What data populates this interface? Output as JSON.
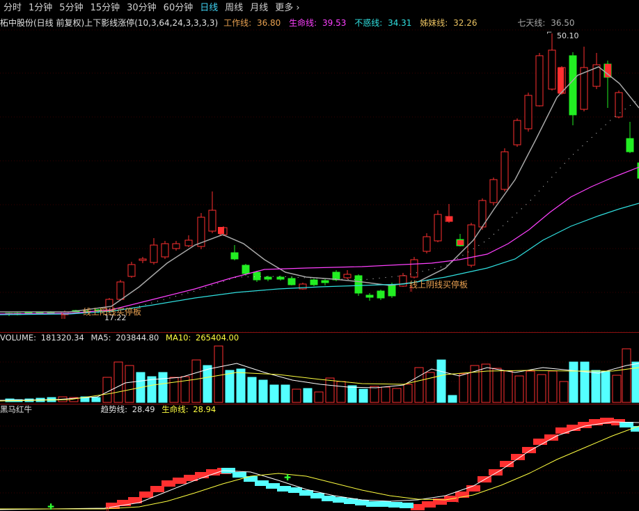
{
  "toolbar": {
    "items": [
      "分时",
      "1分钟",
      "5分钟",
      "15分钟",
      "30分钟",
      "60分钟",
      "日线",
      "周线",
      "月线"
    ],
    "active": "日线",
    "more": "更多",
    "more_icon": "chevron-right-icon"
  },
  "header": {
    "stock": "柘中股份(日线 前复权)",
    "indicator": "上下影线涨停(10,3,64,24,3,3,3,3)",
    "work_label": "工作线:",
    "work_value": "36.80",
    "life_label": "生命线:",
    "life_value": "39.53",
    "bhx_label": "不惑线:",
    "bhx_value": "34.31",
    "sister_label": "姊妹线:",
    "sister_value": "32.26",
    "seven_label": "七天线:",
    "seven_value": "36.50"
  },
  "price_chart": {
    "high_label": "50.10",
    "low_label": "17.22",
    "annotation_left": "线上阳线买停板",
    "annotation_right": "线上阴线买停板"
  },
  "volume_panel": {
    "volume_label": "VOLUME:",
    "volume_value": "181320.34",
    "ma5_label": "MA5:",
    "ma5_value": "203844.80",
    "ma10_label": "MA10:",
    "ma10_value": "265404.00"
  },
  "indicator_panel": {
    "name": "黑马红牛",
    "trend_label": "趋势线:",
    "trend_value": "28.49",
    "life_label": "生命线:",
    "life_value": "28.94"
  },
  "colors": {
    "up": "#ff3030",
    "down": "#54ffff",
    "down_candle": "#22ee22",
    "work": "#e8a050",
    "life": "#ff40ff",
    "bhx": "#30e0e0",
    "sister": "#e8c060",
    "seven": "#a8a8a8",
    "ma5": "#ffffff",
    "ma10": "#ffff40",
    "active_tab": "#3fd0f0"
  }
}
